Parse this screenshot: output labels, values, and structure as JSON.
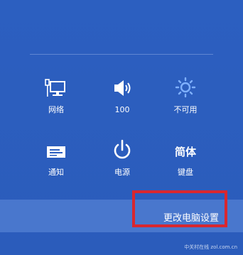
{
  "quick_settings": {
    "network": {
      "label": "网络",
      "icon": "network-icon"
    },
    "volume": {
      "label": "100",
      "icon": "volume-icon"
    },
    "brightness": {
      "label": "不可用",
      "icon": "brightness-icon"
    },
    "notifications": {
      "label": "通知",
      "icon": "notifications-icon"
    },
    "power": {
      "label": "电源",
      "icon": "power-icon"
    },
    "keyboard": {
      "label": "键盘",
      "ime_mode": "简体",
      "icon": "keyboard-icon"
    }
  },
  "footer": {
    "change_pc_settings": "更改电脑设置"
  },
  "watermark": "中关村在线 zol.com.cn",
  "colors": {
    "panel_bg": "#2c5fc0",
    "footer_bg": "#4977cd",
    "highlight": "#d8272f",
    "icon_accent": "#7fb0ff"
  }
}
